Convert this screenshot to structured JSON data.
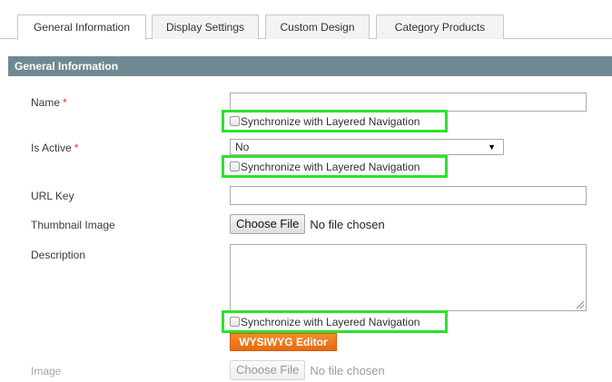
{
  "tabs": [
    {
      "label": "General Information",
      "active": true
    },
    {
      "label": "Display Settings",
      "active": false
    },
    {
      "label": "Custom Design",
      "active": false
    },
    {
      "label": "Category Products",
      "active": false
    }
  ],
  "section": {
    "title": "General Information"
  },
  "fields": {
    "name": {
      "label": "Name",
      "required": "*",
      "value": ""
    },
    "is_active": {
      "label": "Is Active",
      "required": "*",
      "selected": "No"
    },
    "url_key": {
      "label": "URL Key",
      "value": ""
    },
    "thumbnail": {
      "label": "Thumbnail Image",
      "button": "Choose File",
      "status": "No file chosen"
    },
    "description": {
      "label": "Description",
      "value": ""
    },
    "image": {
      "label": "Image",
      "button": "Choose File",
      "status": "No file chosen"
    }
  },
  "sync_label": "Synchronize with Layered Navigation",
  "wysiwyg_label": "WYSIWYG Editor",
  "colors": {
    "section_bar": "#6f8992",
    "highlight": "#2de12d",
    "required": "#eb340a",
    "wysiwyg": "#f07a1e"
  }
}
